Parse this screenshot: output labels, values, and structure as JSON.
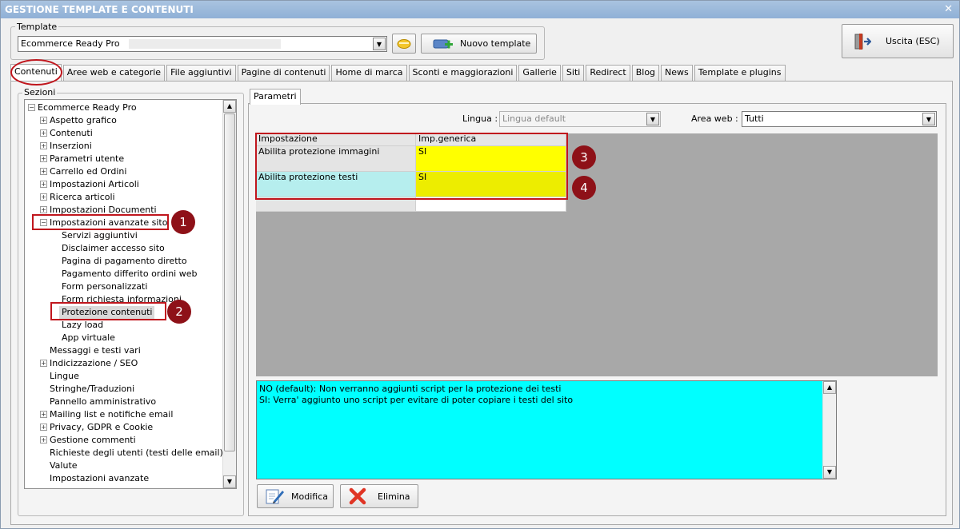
{
  "window": {
    "title": "GESTIONE TEMPLATE E CONTENUTI",
    "close_glyph": "✕"
  },
  "template_group": {
    "label": "Template",
    "selected": "Ecommerce Ready Pro",
    "new_button": "Nuovo template"
  },
  "exit_button": "Uscita (ESC)",
  "tabs": [
    "Contenuti",
    "Aree web e categorie",
    "File aggiuntivi",
    "Pagine di contenuti",
    "Home di marca",
    "Sconti e maggiorazioni",
    "Gallerie",
    "Siti",
    "Redirect",
    "Blog",
    "News",
    "Template e plugins"
  ],
  "sections": {
    "label": "Sezioni",
    "tree": [
      {
        "label": "Ecommerce Ready Pro",
        "level": 0,
        "expander": "−"
      },
      {
        "label": "Aspetto grafico",
        "level": 1,
        "expander": "+"
      },
      {
        "label": "Contenuti",
        "level": 1,
        "expander": "+"
      },
      {
        "label": "Inserzioni",
        "level": 1,
        "expander": "+"
      },
      {
        "label": "Parametri utente",
        "level": 1,
        "expander": "+"
      },
      {
        "label": "Carrello ed Ordini",
        "level": 1,
        "expander": "+"
      },
      {
        "label": "Impostazioni Articoli",
        "level": 1,
        "expander": "+"
      },
      {
        "label": "Ricerca articoli",
        "level": 1,
        "expander": "+"
      },
      {
        "label": "Impostazioni Documenti",
        "level": 1,
        "expander": "+"
      },
      {
        "label": "Impostazioni avanzate sito",
        "level": 1,
        "expander": "−"
      },
      {
        "label": "Servizi aggiuntivi",
        "level": 2,
        "expander": ""
      },
      {
        "label": "Disclaimer accesso sito",
        "level": 2,
        "expander": ""
      },
      {
        "label": "Pagina di pagamento diretto",
        "level": 2,
        "expander": ""
      },
      {
        "label": "Pagamento differito ordini web",
        "level": 2,
        "expander": ""
      },
      {
        "label": "Form personalizzati",
        "level": 2,
        "expander": ""
      },
      {
        "label": "Form richiesta informazioni",
        "level": 2,
        "expander": ""
      },
      {
        "label": "Protezione contenuti",
        "level": 2,
        "expander": ""
      },
      {
        "label": "Lazy load",
        "level": 2,
        "expander": ""
      },
      {
        "label": "App virtuale",
        "level": 2,
        "expander": ""
      },
      {
        "label": "Messaggi e testi vari",
        "level": 1,
        "expander": ""
      },
      {
        "label": "Indicizzazione / SEO",
        "level": 1,
        "expander": "+"
      },
      {
        "label": "Lingue",
        "level": 1,
        "expander": ""
      },
      {
        "label": "Stringhe/Traduzioni",
        "level": 1,
        "expander": ""
      },
      {
        "label": "Pannello amministrativo",
        "level": 1,
        "expander": ""
      },
      {
        "label": "Mailing list e notifiche email",
        "level": 1,
        "expander": "+"
      },
      {
        "label": "Privacy, GDPR e Cookie",
        "level": 1,
        "expander": "+"
      },
      {
        "label": "Gestione commenti",
        "level": 1,
        "expander": "+"
      },
      {
        "label": "Richieste degli utenti (testi delle email)",
        "level": 1,
        "expander": ""
      },
      {
        "label": "Valute",
        "level": 1,
        "expander": ""
      },
      {
        "label": "Impostazioni avanzate",
        "level": 1,
        "expander": ""
      }
    ]
  },
  "params": {
    "tab_label": "Parametri",
    "language_label": "Lingua :",
    "language_value": "Lingua default",
    "area_label": "Area web :",
    "area_value": "Tutti",
    "columns": [
      "Impostazione",
      "Imp.generica"
    ],
    "rows": [
      {
        "setting": "Abilita protezione immagini",
        "value": "SI"
      },
      {
        "setting": "Abilita protezione testi",
        "value": "SI"
      }
    ],
    "description": [
      "NO (default): Non verranno aggiunti script per la protezione dei testi",
      "SI: Verra' aggiunto uno script per evitare di poter copiare i testi del sito"
    ],
    "edit_button": "Modifica",
    "delete_button": "Elimina"
  },
  "callouts": [
    "1",
    "2",
    "3",
    "4"
  ],
  "colors": {
    "accent_red": "#c0161d",
    "badge": "#8e1118",
    "yellow": "#ffff00",
    "cyan": "#00ffff",
    "title_bar": "#9ab7db"
  }
}
